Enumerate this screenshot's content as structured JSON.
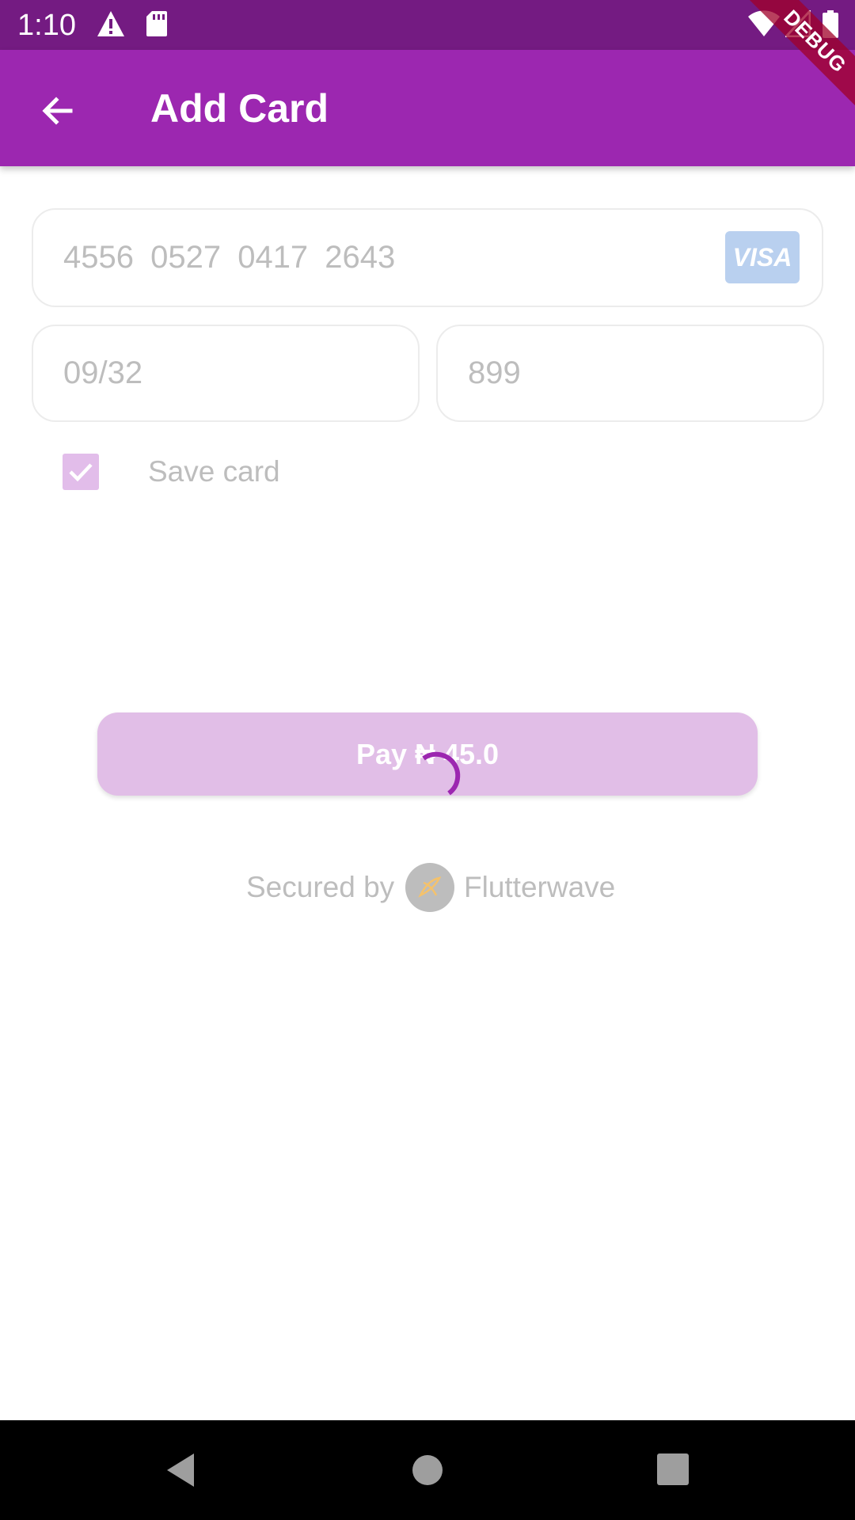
{
  "status_bar": {
    "time": "1:10",
    "icons": [
      "warning-icon",
      "sd-card-icon",
      "wifi-icon",
      "signal-icon",
      "battery-icon"
    ],
    "background": "#741B82"
  },
  "debug_banner": "DEBUG",
  "app_bar": {
    "title": "Add Card",
    "back_icon": "arrow-back-icon",
    "background": "#9C27B0"
  },
  "form": {
    "card_number": "4556  0527  0417  2643",
    "card_brand": "VISA",
    "expiry": "09/32",
    "cvv": "899",
    "save_card": {
      "label": "Save card",
      "checked": true
    }
  },
  "pay_button": {
    "label": "Pay  ₦ 45.0",
    "loading": true
  },
  "footer": {
    "secured_by": "Secured by",
    "brand": "Flutterwave",
    "brand_icon": "flutterwave-logo-icon"
  },
  "nav_bar": {
    "buttons": [
      "back-triangle-icon",
      "home-circle-icon",
      "recents-square-icon"
    ]
  },
  "colors": {
    "accent": "#9C27B0",
    "disabled_accent": "#E1BEE7",
    "placeholder_text": "#BDBDBD",
    "spinner": "#9C27B0"
  }
}
